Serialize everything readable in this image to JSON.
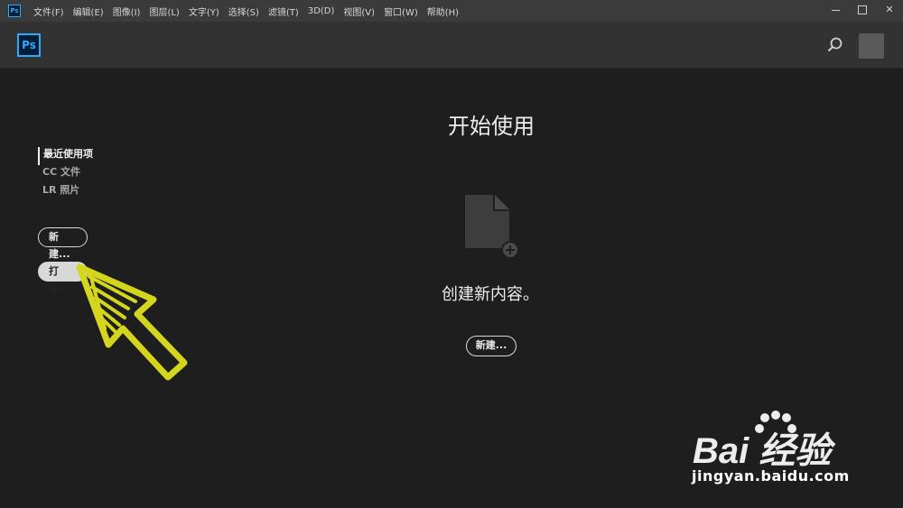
{
  "app": {
    "mini_logo": "Ps",
    "logo": "Ps"
  },
  "menu": {
    "items": [
      "文件(F)",
      "编辑(E)",
      "图像(I)",
      "图层(L)",
      "文字(Y)",
      "选择(S)",
      "滤镜(T)",
      "3D(D)",
      "视图(V)",
      "窗口(W)",
      "帮助(H)"
    ]
  },
  "window": {
    "close": "✕"
  },
  "sidebar": {
    "nav": [
      {
        "label": "最近使用项",
        "active": true
      },
      {
        "label": "CC 文件",
        "active": false
      },
      {
        "label": "LR 照片",
        "active": false
      }
    ],
    "new_label": "新建...",
    "open_label": "打开..."
  },
  "main": {
    "title": "开始使用",
    "create_text": "创建新内容。",
    "new_label": "新建..."
  },
  "watermark": {
    "brand": "Bai 经验",
    "url": "jingyan.baidu.com"
  },
  "colors": {
    "accent": "#31a8ff",
    "background": "#1e1e1e",
    "header": "#323232",
    "annotation": "#d4d61e"
  },
  "icons": [
    "search-icon",
    "file-add-icon",
    "minimize-icon",
    "maximize-icon",
    "close-icon",
    "arrow-annotation"
  ]
}
